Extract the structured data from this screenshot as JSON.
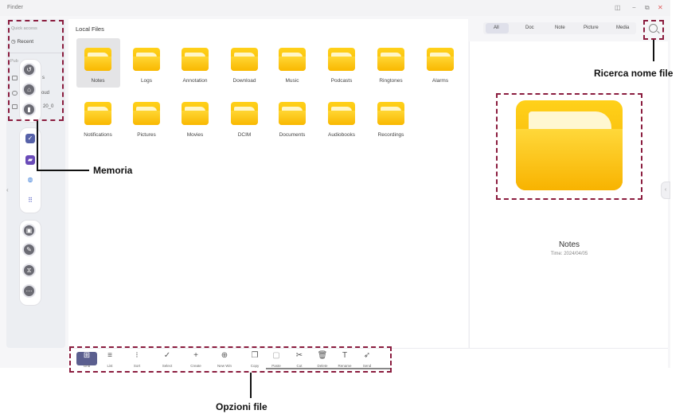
{
  "window": {
    "title": "Finder",
    "controls": [
      "◫",
      "−",
      "⧉",
      "✕"
    ]
  },
  "sidebar": {
    "quick_access_label": "Quick access",
    "recent_label": "Recent",
    "public_label": "Pub",
    "items": [
      {
        "label": "s"
      },
      {
        "label": "oud"
      },
      {
        "label": "20_0"
      }
    ],
    "collapse_glyph": "‹"
  },
  "content": {
    "title": "Local Files",
    "filters": [
      "All",
      "Doc",
      "Note",
      "Picture",
      "Media"
    ],
    "active_filter": "All",
    "folders_row1": [
      "Notes",
      "Logs",
      "Annotation",
      "Download",
      "Music",
      "Podcasts",
      "Ringtones",
      "Alarms"
    ],
    "folders_row2": [
      "Notifications",
      "Pictures",
      "Movies",
      "DCIM",
      "Documents",
      "Audiobooks",
      "Recordings"
    ],
    "selected_folder": "Notes"
  },
  "preview": {
    "name": "Notes",
    "time": "Time: 2024/04/05",
    "handle_glyph": "‹"
  },
  "toolbar": {
    "buttons": [
      {
        "label": "Grid",
        "icon": "⊞"
      },
      {
        "label": "List",
        "icon": "≡"
      },
      {
        "label": "Sort",
        "icon": "⁝"
      },
      {
        "label": "Select",
        "icon": "✓"
      },
      {
        "label": "Create",
        "icon": "+"
      },
      {
        "label": "New Win",
        "icon": "⊕"
      },
      {
        "label": "Copy",
        "icon": "❐"
      },
      {
        "label": "Paste",
        "icon": "▢"
      },
      {
        "label": "Cut",
        "icon": "✂"
      },
      {
        "label": "Delete",
        "icon": "🗑"
      },
      {
        "label": "Rename",
        "icon": "T"
      },
      {
        "label": "Send",
        "icon": "➶"
      }
    ]
  },
  "callouts": {
    "search": "Ricerca nome file",
    "memory": "Memoria",
    "file_options": "Opzioni file"
  },
  "colors": {
    "accent": "#5b5f8f",
    "annotation": "#8b1d3f",
    "folder": "#f7b500"
  }
}
